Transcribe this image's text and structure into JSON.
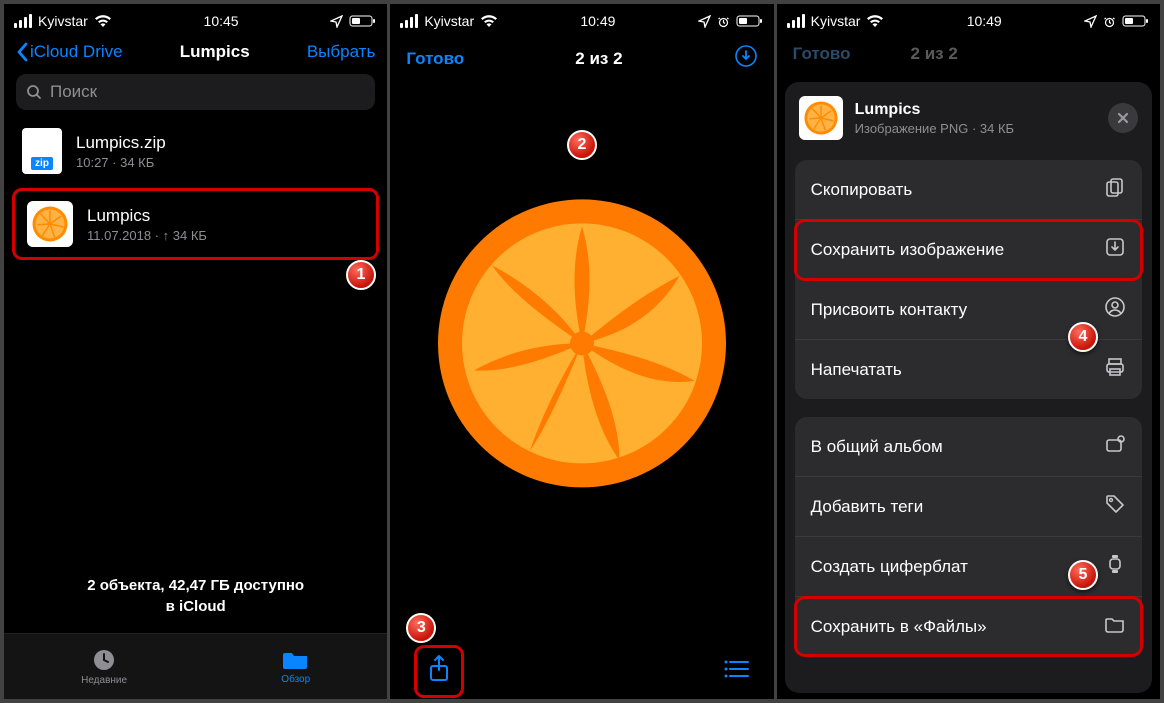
{
  "status": {
    "carrier": "Kyivstar",
    "time1": "10:45",
    "time2": "10:49",
    "time3": "10:49"
  },
  "panel1": {
    "back_label": "iCloud Drive",
    "title": "Lumpics",
    "select_label": "Выбрать",
    "search_placeholder": "Поиск",
    "files": [
      {
        "name": "Lumpics.zip",
        "meta": "10:27 · 34 КБ",
        "zip_badge": "zip"
      },
      {
        "name": "Lumpics",
        "meta": "11.07.2018 · ↑ 34 КБ"
      }
    ],
    "footer": "2 объекта, 42,47 ГБ доступно\nв iCloud",
    "tabs": {
      "recent": "Недавние",
      "browse": "Обзор"
    }
  },
  "panel2": {
    "done": "Готово",
    "counter": "2 из 2"
  },
  "panel3": {
    "dim_done": "Готово",
    "dim_count": "2 из 2",
    "sheet_title": "Lumpics",
    "sheet_subtitle": "Изображение PNG · 34 КБ",
    "actions1": [
      "Скопировать",
      "Сохранить изображение",
      "Присвоить контакту",
      "Напечатать"
    ],
    "actions2": [
      "В общий альбом",
      "Добавить теги",
      "Создать циферблат",
      "Сохранить в «Файлы»"
    ]
  },
  "markers": {
    "m1": "1",
    "m2": "2",
    "m3": "3",
    "m4": "4",
    "m5": "5"
  }
}
